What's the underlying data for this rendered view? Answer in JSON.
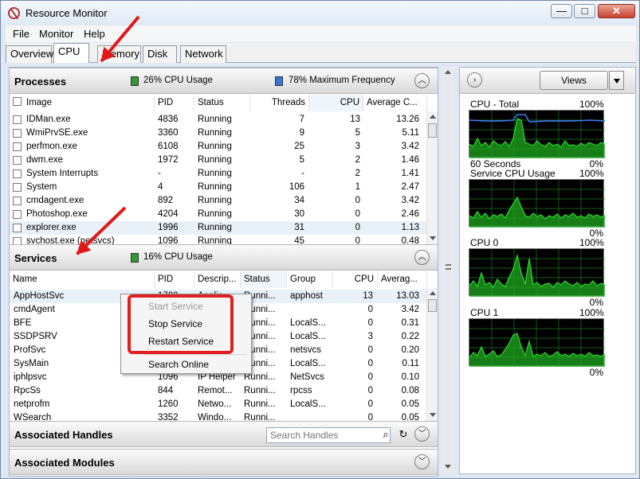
{
  "window": {
    "title": "Resource Monitor",
    "controls": {
      "minimize": "—",
      "maximize": "□",
      "close": "✕"
    }
  },
  "menu": [
    "File",
    "Monitor",
    "Help"
  ],
  "tabs": [
    "Overview",
    "CPU",
    "Memory",
    "Disk",
    "Network"
  ],
  "processes": {
    "title": "Processes",
    "cpu_usage": "26% CPU Usage",
    "max_frequency": "78% Maximum Frequency",
    "columns": [
      "Image",
      "PID",
      "Status",
      "Threads",
      "CPU",
      "Average C..."
    ],
    "rows": [
      {
        "image": "IDMan.exe",
        "pid": "4836",
        "status": "Running",
        "threads": "7",
        "cpu": "13",
        "avg": "13.26"
      },
      {
        "image": "WmiPrvSE.exe",
        "pid": "3360",
        "status": "Running",
        "threads": "9",
        "cpu": "5",
        "avg": "5.11"
      },
      {
        "image": "perfmon.exe",
        "pid": "6108",
        "status": "Running",
        "threads": "25",
        "cpu": "3",
        "avg": "3.42"
      },
      {
        "image": "dwm.exe",
        "pid": "1972",
        "status": "Running",
        "threads": "5",
        "cpu": "2",
        "avg": "1.46"
      },
      {
        "image": "System Interrupts",
        "pid": "-",
        "status": "Running",
        "threads": "-",
        "cpu": "2",
        "avg": "1.41"
      },
      {
        "image": "System",
        "pid": "4",
        "status": "Running",
        "threads": "106",
        "cpu": "1",
        "avg": "2.47"
      },
      {
        "image": "cmdagent.exe",
        "pid": "892",
        "status": "Running",
        "threads": "34",
        "cpu": "0",
        "avg": "3.42"
      },
      {
        "image": "Photoshop.exe",
        "pid": "4204",
        "status": "Running",
        "threads": "30",
        "cpu": "0",
        "avg": "2.46"
      },
      {
        "image": "explorer.exe",
        "pid": "1996",
        "status": "Running",
        "threads": "31",
        "cpu": "0",
        "avg": "1.13"
      },
      {
        "image": "svchost.exe (netsvcs)",
        "pid": "1096",
        "status": "Running",
        "threads": "45",
        "cpu": "0",
        "avg": "0.48"
      }
    ]
  },
  "services": {
    "title": "Services",
    "cpu_usage": "16% CPU Usage",
    "columns": [
      "Name",
      "PID",
      "Descrip...",
      "Status",
      "Group",
      "CPU",
      "Averag..."
    ],
    "rows": [
      {
        "name": "AppHostSvc",
        "pid": "1708",
        "desc": "Applic...",
        "status": "Runni...",
        "group": "apphost",
        "cpu": "13",
        "avg": "13.03"
      },
      {
        "name": "cmdAgent",
        "pid": "",
        "desc": "",
        "status": "Runni...",
        "group": "",
        "cpu": "0",
        "avg": "3.42"
      },
      {
        "name": "BFE",
        "pid": "",
        "desc": "",
        "status": "Runni...",
        "group": "LocalS...",
        "cpu": "0",
        "avg": "0.31"
      },
      {
        "name": "SSDPSRV",
        "pid": "",
        "desc": "",
        "status": "Runni...",
        "group": "LocalS...",
        "cpu": "3",
        "avg": "0.22"
      },
      {
        "name": "ProfSvc",
        "pid": "",
        "desc": "",
        "status": "Runni...",
        "group": "netsvcs",
        "cpu": "0",
        "avg": "0.20"
      },
      {
        "name": "SysMain",
        "pid": "",
        "desc": "",
        "status": "Runni...",
        "group": "LocalS...",
        "cpu": "0",
        "avg": "0.11"
      },
      {
        "name": "iphlpsvc",
        "pid": "1096",
        "desc": "IP Helper",
        "status": "Runni...",
        "group": "NetSvcs",
        "cpu": "0",
        "avg": "0.10"
      },
      {
        "name": "RpcSs",
        "pid": "844",
        "desc": "Remot...",
        "status": "Runni...",
        "group": "rpcss",
        "cpu": "0",
        "avg": "0.08"
      },
      {
        "name": "netprofm",
        "pid": "1260",
        "desc": "Netwo...",
        "status": "Runni...",
        "group": "LocalS...",
        "cpu": "0",
        "avg": "0.05"
      },
      {
        "name": "WSearch",
        "pid": "3352",
        "desc": "Windo...",
        "status": "Runni...",
        "group": "",
        "cpu": "0",
        "avg": "0.05"
      }
    ]
  },
  "context_menu": [
    "Start Service",
    "Stop Service",
    "Restart Service",
    "Search Online"
  ],
  "handles": {
    "title": "Associated Handles",
    "search_placeholder": "Search Handles"
  },
  "modules": {
    "title": "Associated Modules"
  },
  "right_panel": {
    "views_label": "Views",
    "graphs": [
      {
        "title": "CPU - Total",
        "top": "100%",
        "bottom_left": "60 Seconds",
        "bottom": "0%"
      },
      {
        "title": "Service CPU Usage",
        "top": "100%",
        "bottom_left": "",
        "bottom": "0%"
      },
      {
        "title": "CPU 0",
        "top": "100%",
        "bottom_left": "",
        "bottom": "0%"
      },
      {
        "title": "CPU 1",
        "top": "100%",
        "bottom_left": "",
        "bottom": "0%"
      }
    ]
  },
  "colors": {
    "accent": "#3a73d2",
    "graph_line": "#27d827",
    "annotation": "#e01818"
  }
}
